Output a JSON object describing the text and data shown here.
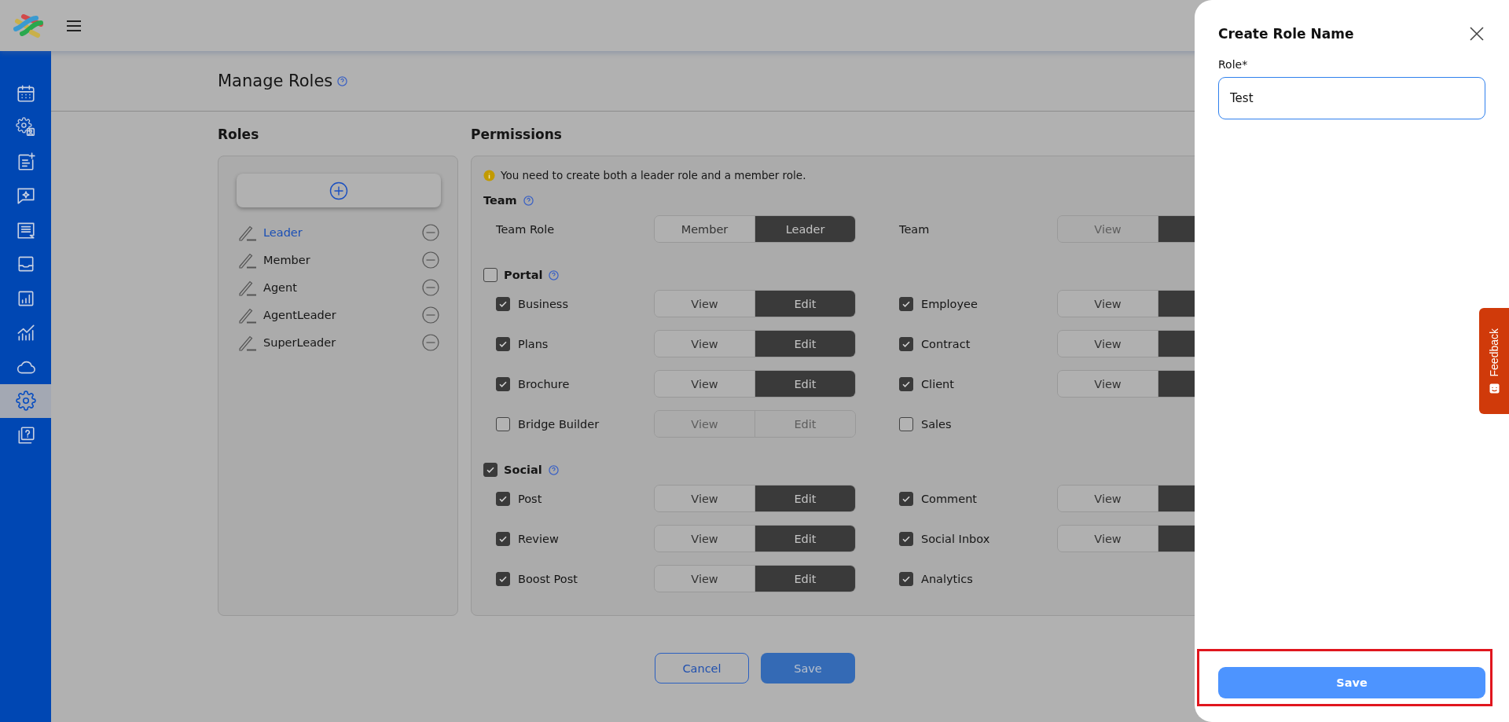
{
  "sidebar": {
    "items": [
      {
        "selected": false
      },
      {
        "selected": false
      },
      {
        "selected": false
      },
      {
        "selected": false
      },
      {
        "selected": false
      },
      {
        "selected": false
      },
      {
        "selected": false
      },
      {
        "selected": false
      },
      {
        "selected": false
      },
      {
        "selected": true
      },
      {
        "selected": false
      }
    ]
  },
  "page": {
    "title": "Manage Roles"
  },
  "roles": {
    "heading": "Roles",
    "items": [
      {
        "name": "Leader",
        "selected": true
      },
      {
        "name": "Member",
        "selected": false
      },
      {
        "name": "Agent",
        "selected": false
      },
      {
        "name": "AgentLeader",
        "selected": false
      },
      {
        "name": "SuperLeader",
        "selected": false
      }
    ]
  },
  "permissions": {
    "heading": "Permissions",
    "notice": "You need to create both a leader role and a member role.",
    "sections": [
      {
        "title": "Team",
        "items": [
          {
            "label": "Team Role",
            "options": [
              {
                "label": "Member",
                "selected": false,
                "disabled": false
              },
              {
                "label": "Leader",
                "selected": true,
                "disabled": false
              }
            ]
          },
          {
            "label": "Team",
            "options": [
              {
                "label": "View",
                "selected": false,
                "disabled": true
              },
              {
                "selected": true,
                "disabled": false
              }
            ]
          }
        ]
      },
      {
        "title": "Portal",
        "checked": false,
        "items": [
          {
            "label": "Business",
            "checked": true,
            "options": [
              {
                "label": "View",
                "selected": false,
                "disabled": false
              },
              {
                "label": "Edit",
                "selected": true,
                "disabled": false
              }
            ]
          },
          {
            "label": "Employee",
            "checked": true,
            "options": [
              {
                "label": "View",
                "selected": false,
                "disabled": false
              },
              {
                "selected": true,
                "disabled": false
              }
            ]
          },
          {
            "label": "Plans",
            "checked": true,
            "options": [
              {
                "label": "View",
                "selected": false,
                "disabled": false
              },
              {
                "label": "Edit",
                "selected": true,
                "disabled": false
              }
            ]
          },
          {
            "label": "Contract",
            "checked": true,
            "options": [
              {
                "label": "View",
                "selected": false,
                "disabled": false
              },
              {
                "selected": true,
                "disabled": false
              }
            ]
          },
          {
            "label": "Brochure",
            "checked": true,
            "options": [
              {
                "label": "View",
                "selected": false,
                "disabled": false
              },
              {
                "label": "Edit",
                "selected": true,
                "disabled": false
              }
            ]
          },
          {
            "label": "Client",
            "checked": true,
            "options": [
              {
                "label": "View",
                "selected": false,
                "disabled": false
              },
              {
                "selected": true,
                "disabled": false
              }
            ]
          },
          {
            "label": "Bridge Builder",
            "checked": false,
            "options": [
              {
                "label": "View",
                "selected": false,
                "disabled": true
              },
              {
                "label": "Edit",
                "selected": false,
                "disabled": true
              }
            ]
          },
          {
            "label": "Sales",
            "checked": false
          }
        ]
      },
      {
        "title": "Social",
        "checked": true,
        "items": [
          {
            "label": "Post",
            "checked": true,
            "options": [
              {
                "label": "View",
                "selected": false,
                "disabled": false
              },
              {
                "label": "Edit",
                "selected": true,
                "disabled": false
              }
            ]
          },
          {
            "label": "Comment",
            "checked": true,
            "options": [
              {
                "label": "View",
                "selected": false,
                "disabled": false
              },
              {
                "selected": true,
                "disabled": false
              }
            ]
          },
          {
            "label": "Review",
            "checked": true,
            "options": [
              {
                "label": "View",
                "selected": false,
                "disabled": false
              },
              {
                "label": "Edit",
                "selected": true,
                "disabled": false
              }
            ]
          },
          {
            "label": "Social Inbox",
            "checked": true,
            "options": [
              {
                "label": "View",
                "selected": false,
                "disabled": false
              },
              {
                "selected": true,
                "disabled": false
              }
            ]
          },
          {
            "label": "Boost Post",
            "checked": true,
            "options": [
              {
                "label": "View",
                "selected": false,
                "disabled": false
              },
              {
                "label": "Edit",
                "selected": true,
                "disabled": false
              }
            ]
          },
          {
            "label": "Analytics",
            "checked": true
          }
        ]
      }
    ]
  },
  "actions": [
    {
      "label": "Cancel",
      "kind": "secondary"
    },
    {
      "label": "Save",
      "kind": "primary"
    }
  ],
  "drawer": {
    "title": "Create Role Name",
    "field": {
      "label": "Role*",
      "value": "Test"
    },
    "submit": "Save"
  },
  "feedback": {
    "label": "Feedback"
  }
}
